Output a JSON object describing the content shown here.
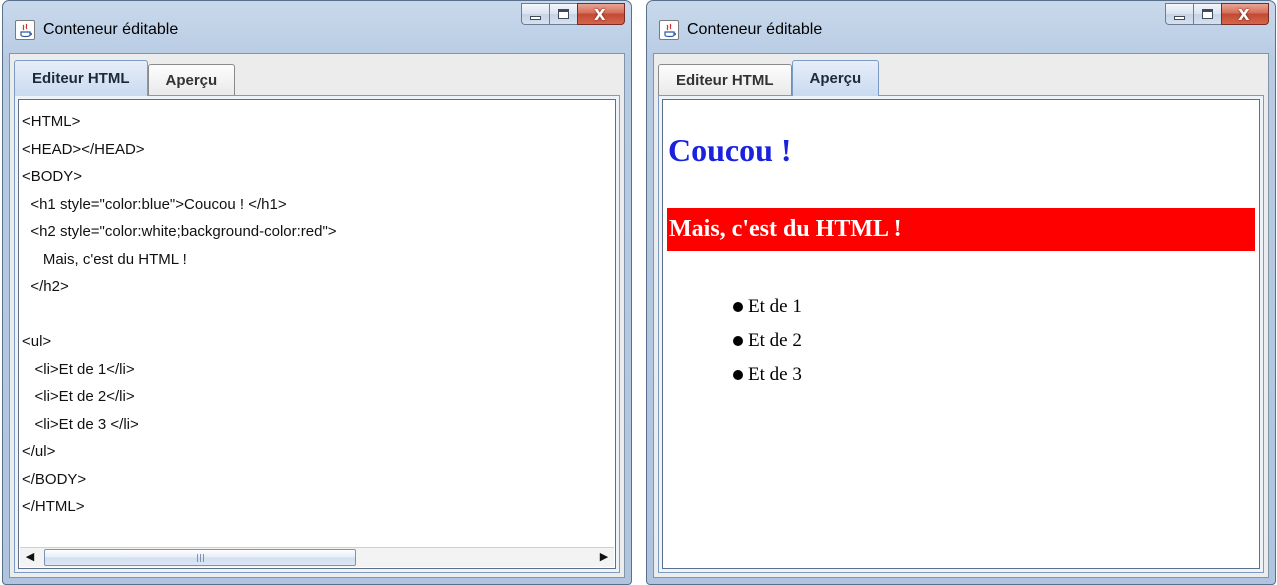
{
  "windows": {
    "left": {
      "title": "Conteneur éditable",
      "tabs": [
        "Editeur HTML",
        "Aperçu"
      ],
      "active_tab": 0,
      "code_lines": [
        "<HTML>",
        "<HEAD></HEAD>",
        "<BODY>",
        "  <h1 style=\"color:blue\">Coucou ! </h1>",
        "  <h2 style=\"color:white;background-color:red\">",
        "     Mais, c'est du HTML !",
        "  </h2>",
        "",
        "<ul>",
        "   <li>Et de 1</li>",
        "   <li>Et de 2</li>",
        "   <li>Et de 3 </li>",
        "</ul>",
        "</BODY>",
        "</HTML>"
      ],
      "scrollbar": {
        "left_arrow": "◀",
        "right_arrow": "▶"
      }
    },
    "right": {
      "title": "Conteneur éditable",
      "tabs": [
        "Editeur HTML",
        "Aperçu"
      ],
      "active_tab": 1,
      "preview": {
        "h1": "Coucou !",
        "h1_color": "#1a22e0",
        "h2": "Mais, c'est du HTML !",
        "h2_color": "#ffffff",
        "h2_background": "#ff0000",
        "list_items": [
          "Et de 1",
          "Et de 2",
          "Et de 3"
        ]
      }
    }
  },
  "caption_buttons": {
    "minimize_icon": "minimize-icon",
    "maximize_icon": "maximize-icon",
    "close_icon": "close-icon",
    "close_glyph": "X"
  },
  "colors": {
    "frame": "#b7cbe3",
    "close_button": "#c24a33",
    "active_tab": "#c9daf0"
  }
}
